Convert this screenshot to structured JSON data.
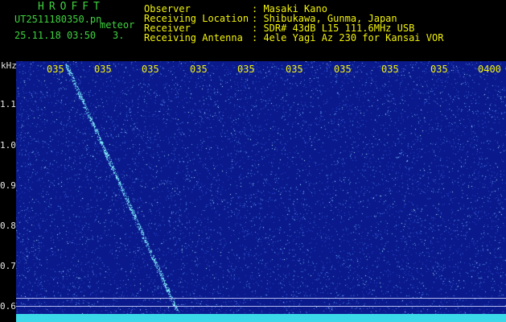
{
  "header": {
    "app_title": "HROFFT",
    "file_name": "UT2511180350.pn",
    "file_suffix": "meteor",
    "timestamp": "25.11.18 03:50",
    "frame_no": "3.",
    "rows": [
      {
        "label": "Observer",
        "value": ": Masaki Kano"
      },
      {
        "label": "Receiving Location",
        "value": ": Shibukawa, Gunma, Japan"
      },
      {
        "label": "Receiver",
        "value": ": SDR# 43dB L15 111.6MHz USB"
      },
      {
        "label": "Receiving Antenna",
        "value": ": 4ele Yagi Az 230 for Kansai VOR"
      }
    ]
  },
  "spectrogram": {
    "y_unit": "kHz",
    "y_ticks": [
      "1.1",
      "1.0",
      "0.9",
      "0.8",
      "0.7",
      "0.6"
    ],
    "x_ticks": [
      "035",
      "035",
      "035",
      "035",
      "035",
      "035",
      "035",
      "035",
      "035",
      "0400"
    ],
    "colors": {
      "background": "#0a1a8c",
      "trace": "#8ff7ff",
      "baseline": "#3ad8e8"
    }
  }
}
